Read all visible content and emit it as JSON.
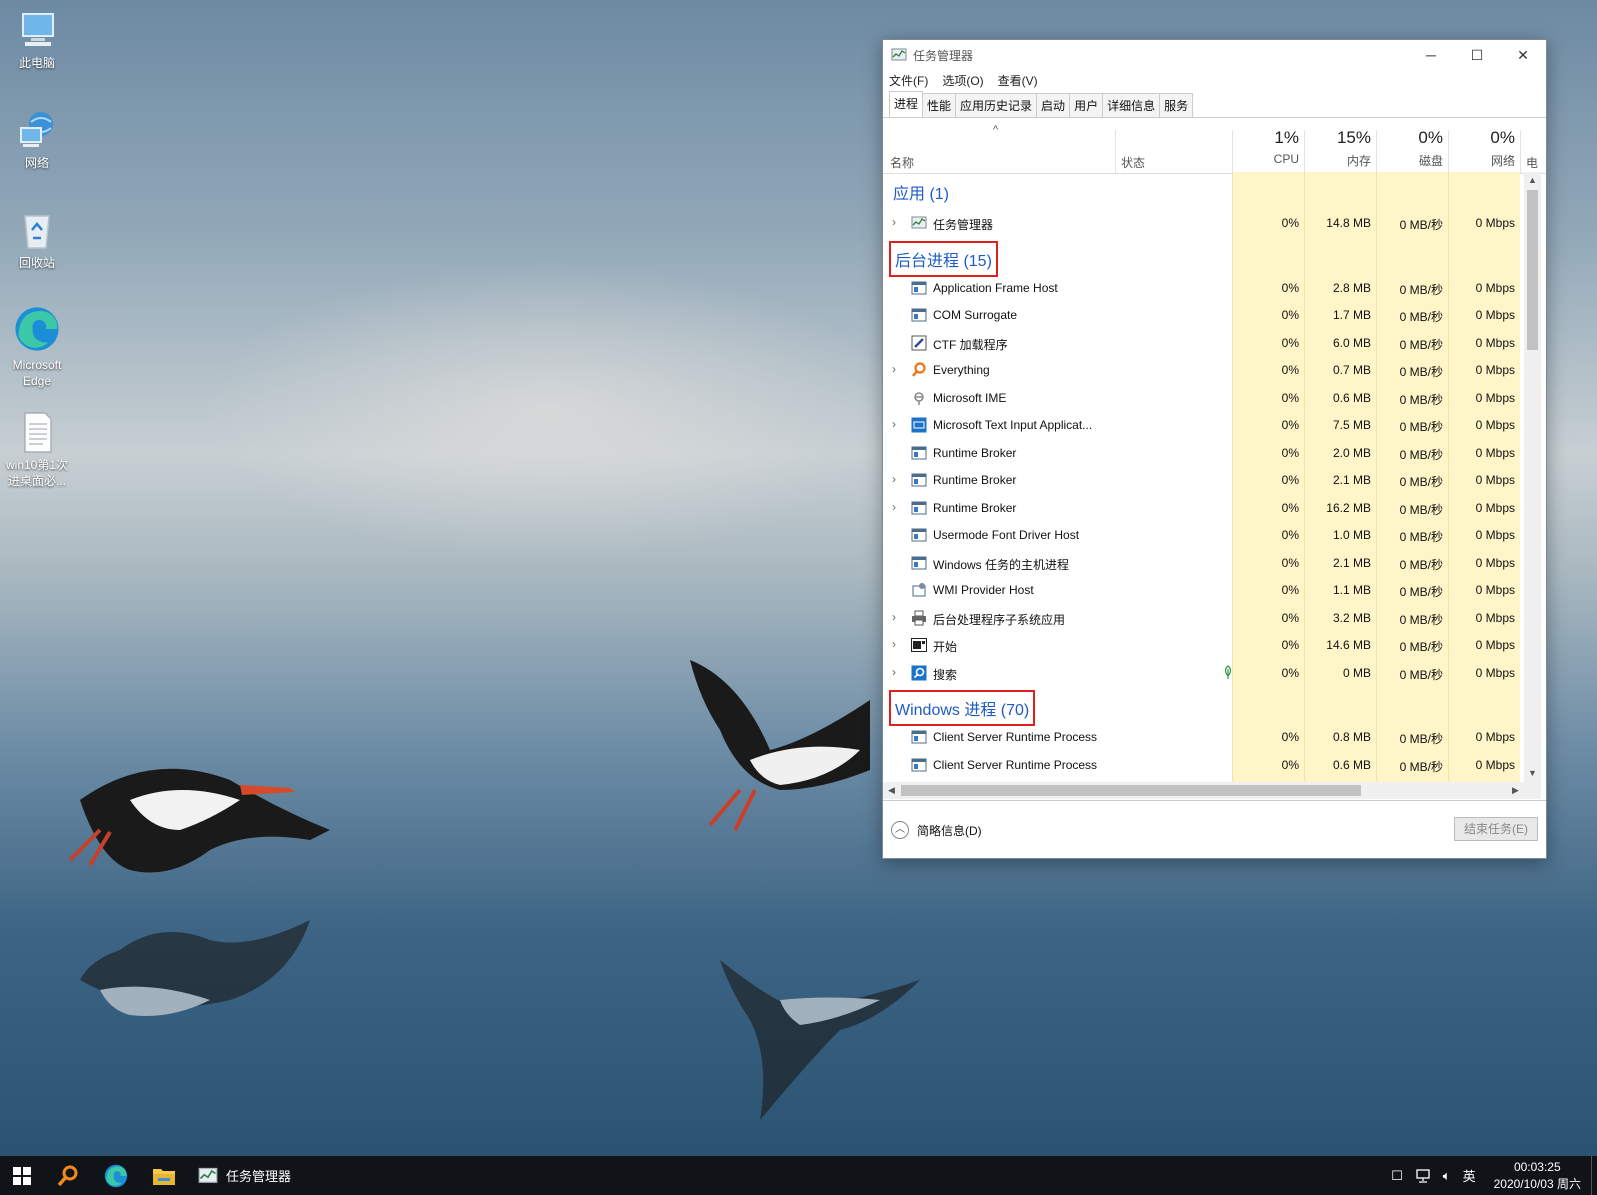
{
  "desktop": {
    "icons": [
      {
        "label": "此电脑",
        "icon": "computer-icon"
      },
      {
        "label": "网络",
        "icon": "network-icon"
      },
      {
        "label": "回收站",
        "icon": "recycle-bin-icon"
      },
      {
        "label": "Microsoft Edge",
        "icon": "edge-icon"
      },
      {
        "label": "win10第1次进桌面必...",
        "icon": "text-file-icon"
      }
    ]
  },
  "window": {
    "title": "任务管理器",
    "menu": [
      "文件(F)",
      "选项(O)",
      "查看(V)"
    ],
    "tabs": [
      "进程",
      "性能",
      "应用历史记录",
      "启动",
      "用户",
      "详细信息",
      "服务"
    ],
    "active_tab": "进程",
    "columns": {
      "name": "名称",
      "status": "状态",
      "cpu": {
        "pct": "1%",
        "label": "CPU"
      },
      "memory": {
        "pct": "15%",
        "label": "内存"
      },
      "disk": {
        "pct": "0%",
        "label": "磁盘"
      },
      "network": {
        "pct": "0%",
        "label": "网络"
      },
      "power": {
        "label": "电"
      }
    },
    "groups": {
      "apps": "应用 (1)",
      "background": "后台进程 (15)",
      "windows": "Windows 进程 (70)"
    },
    "app_rows": [
      {
        "name": "任务管理器",
        "cpu": "0%",
        "mem": "14.8 MB",
        "disk": "0 MB/秒",
        "net": "0 Mbps"
      }
    ],
    "background_rows": [
      {
        "name": "Application Frame Host",
        "cpu": "0%",
        "mem": "2.8 MB",
        "disk": "0 MB/秒",
        "net": "0 Mbps"
      },
      {
        "name": "COM Surrogate",
        "cpu": "0%",
        "mem": "1.7 MB",
        "disk": "0 MB/秒",
        "net": "0 Mbps"
      },
      {
        "name": "CTF 加载程序",
        "cpu": "0%",
        "mem": "6.0 MB",
        "disk": "0 MB/秒",
        "net": "0 Mbps"
      },
      {
        "name": "Everything",
        "cpu": "0%",
        "mem": "0.7 MB",
        "disk": "0 MB/秒",
        "net": "0 Mbps"
      },
      {
        "name": "Microsoft IME",
        "cpu": "0%",
        "mem": "0.6 MB",
        "disk": "0 MB/秒",
        "net": "0 Mbps"
      },
      {
        "name": "Microsoft Text Input Applicat...",
        "cpu": "0%",
        "mem": "7.5 MB",
        "disk": "0 MB/秒",
        "net": "0 Mbps"
      },
      {
        "name": "Runtime Broker",
        "cpu": "0%",
        "mem": "2.0 MB",
        "disk": "0 MB/秒",
        "net": "0 Mbps"
      },
      {
        "name": "Runtime Broker",
        "cpu": "0%",
        "mem": "2.1 MB",
        "disk": "0 MB/秒",
        "net": "0 Mbps"
      },
      {
        "name": "Runtime Broker",
        "cpu": "0%",
        "mem": "16.2 MB",
        "disk": "0 MB/秒",
        "net": "0 Mbps"
      },
      {
        "name": "Usermode Font Driver Host",
        "cpu": "0%",
        "mem": "1.0 MB",
        "disk": "0 MB/秒",
        "net": "0 Mbps"
      },
      {
        "name": "Windows 任务的主机进程",
        "cpu": "0%",
        "mem": "2.1 MB",
        "disk": "0 MB/秒",
        "net": "0 Mbps"
      },
      {
        "name": "WMI Provider Host",
        "cpu": "0%",
        "mem": "1.1 MB",
        "disk": "0 MB/秒",
        "net": "0 Mbps"
      },
      {
        "name": "后台处理程序子系统应用",
        "cpu": "0%",
        "mem": "3.2 MB",
        "disk": "0 MB/秒",
        "net": "0 Mbps"
      },
      {
        "name": "开始",
        "cpu": "0%",
        "mem": "14.6 MB",
        "disk": "0 MB/秒",
        "net": "0 Mbps"
      },
      {
        "name": "搜索",
        "cpu": "0%",
        "mem": "0 MB",
        "disk": "0 MB/秒",
        "net": "0 Mbps"
      }
    ],
    "windows_rows": [
      {
        "name": "Client Server Runtime Process",
        "cpu": "0%",
        "mem": "0.8 MB",
        "disk": "0 MB/秒",
        "net": "0 Mbps"
      },
      {
        "name": "Client Server Runtime Process",
        "cpu": "0%",
        "mem": "0.6 MB",
        "disk": "0 MB/秒",
        "net": "0 Mbps"
      }
    ],
    "footer": {
      "fewer_details": "简略信息(D)",
      "end_task": "结束任务(E)"
    }
  },
  "taskbar": {
    "app_label": "任务管理器",
    "ime": "英",
    "time": "00:03:25",
    "date": "2020/10/03 周六"
  }
}
